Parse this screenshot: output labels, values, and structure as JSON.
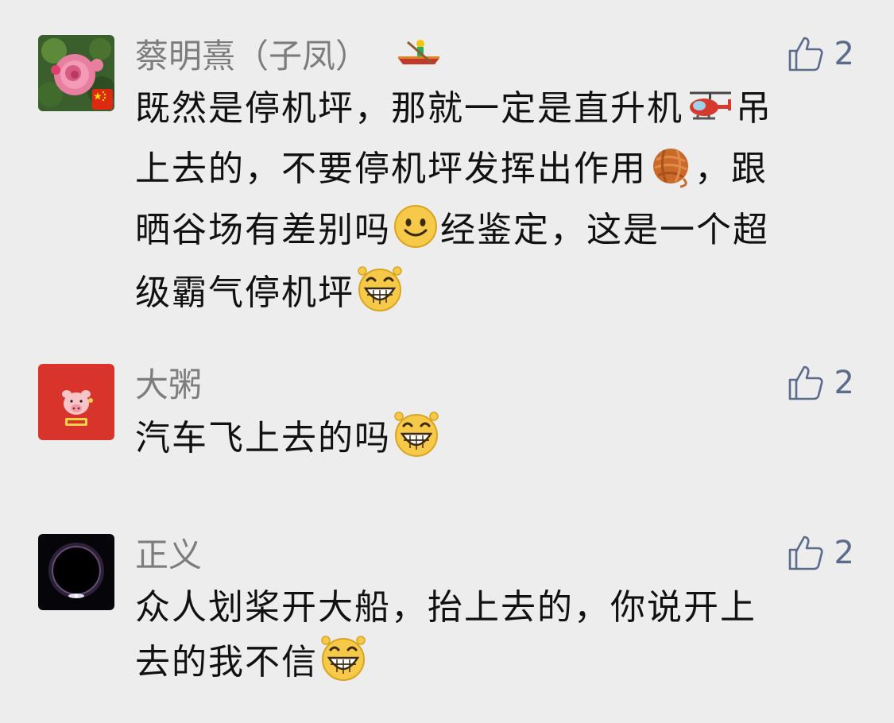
{
  "comments": [
    {
      "username": "蔡明熹（子凤）",
      "likes": "2",
      "lines": [
        [
          "既然是停机坪，那就一定是直升机",
          "helicopter-emoji",
          "吊"
        ],
        [
          "上去的，不要停机坪发挥出作用",
          "yarn-emoji",
          "，跟"
        ],
        [
          "晒谷场有差别吗",
          "smile-emoji",
          "经鉴定，这是一个超"
        ],
        [
          "级霸气停机坪",
          "grin-emoji",
          ""
        ]
      ]
    },
    {
      "username": "大粥",
      "likes": "2",
      "lines": [
        [
          "汽车飞上去的吗",
          "grin-emoji",
          ""
        ]
      ]
    },
    {
      "username": "正义",
      "likes": "2",
      "lines": [
        [
          "众人划桨开大船，抬上去的，你说开上",
          "",
          ""
        ],
        [
          "去的我不信",
          "grin-emoji",
          ""
        ]
      ]
    }
  ],
  "colors": {
    "background": "#ededed",
    "username": "#7d7d7d",
    "like_accent": "#5b6b8c",
    "text": "#111111"
  }
}
